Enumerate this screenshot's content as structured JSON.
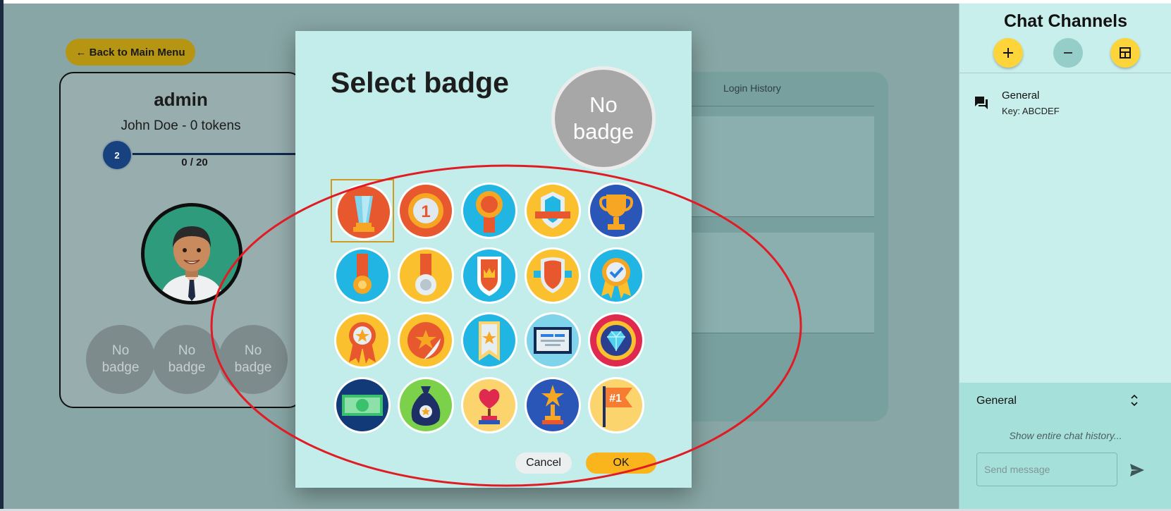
{
  "main": {
    "back_button": "← Back to Main Menu",
    "profile": {
      "username": "admin",
      "fullname_tokens": "John Doe - 0 tokens",
      "level": "2",
      "progress_text": "0 / 20",
      "progress": 0,
      "badge_slots": [
        "No\nbadge",
        "No\nbadge",
        "No\nbadge"
      ]
    },
    "tabs": {
      "login_history": "Login History"
    }
  },
  "sidebar": {
    "title": "Chat Channels",
    "buttons": {
      "add": "add-icon",
      "remove": "remove-icon",
      "layout": "layout-icon"
    },
    "channels": [
      {
        "name": "General",
        "key": "Key: ABCDEF"
      }
    ],
    "chat": {
      "channel": "General",
      "history_link": "Show entire chat history...",
      "input_placeholder": "Send message"
    }
  },
  "dialog": {
    "title": "Select badge",
    "preview": "No\nbadge",
    "badges": [
      "trophy-glass-badge",
      "first-place-medal-badge",
      "gold-ribbon-medal-badge",
      "crest-shield-badge",
      "gold-cup-badge",
      "orange-medal-badge",
      "silver-star-medal-badge",
      "crown-shield-badge",
      "red-shield-badge",
      "check-rosette-badge",
      "star-rosette-badge",
      "star-seal-badge",
      "star-bookmark-badge",
      "certificate-badge",
      "diamond-badge",
      "money-bill-badge",
      "money-bag-badge",
      "heart-trophy-badge",
      "star-trophy-badge",
      "number-one-flag-badge"
    ],
    "selected_index": 0,
    "cancel": "Cancel",
    "ok": "OK"
  },
  "colors": {
    "accent_yellow": "#fbb51c",
    "dialog_bg": "#c2edea",
    "sidebar_bg": "#c8efec",
    "annotation_red": "#e01b24"
  }
}
